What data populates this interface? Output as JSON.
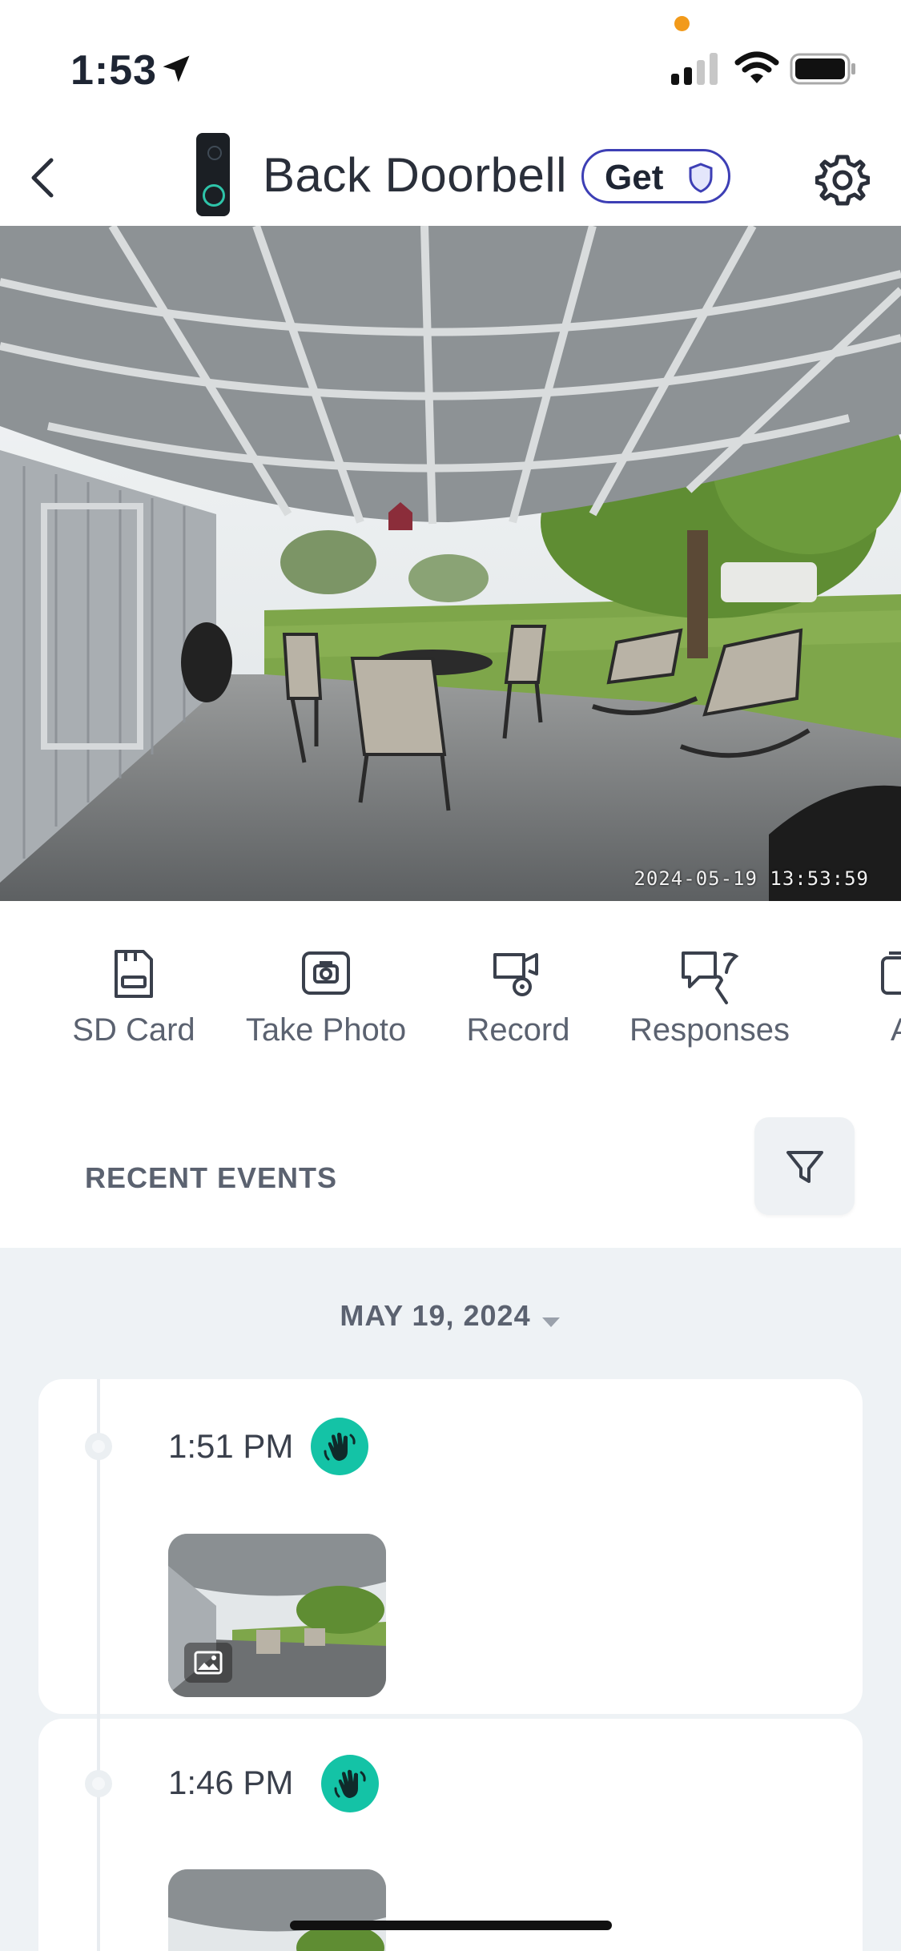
{
  "status_bar": {
    "time": "1:53"
  },
  "header": {
    "title": "Back Doorbell",
    "get_label": "Get"
  },
  "camera": {
    "timestamp": "2024-05-19  13:53:59"
  },
  "actions": [
    {
      "label": "SD Card",
      "icon": "sd-card-icon"
    },
    {
      "label": "Take Photo",
      "icon": "camera-icon"
    },
    {
      "label": "Record",
      "icon": "record-icon"
    },
    {
      "label": "Responses",
      "icon": "responses-icon"
    },
    {
      "label": "Alb",
      "icon": "album-icon"
    }
  ],
  "recent_events": {
    "title": "RECENT EVENTS",
    "date": "MAY 19, 2024",
    "events": [
      {
        "time": "1:51 PM",
        "type_icon": "wave-hand-icon"
      },
      {
        "time": "1:46 PM",
        "type_icon": "wave-hand-icon"
      }
    ]
  },
  "colors": {
    "accent_teal": "#14c3a6",
    "pill_border": "#3d3fb5",
    "events_bg": "#eef2f5",
    "status_dot": "#f29a1a"
  }
}
